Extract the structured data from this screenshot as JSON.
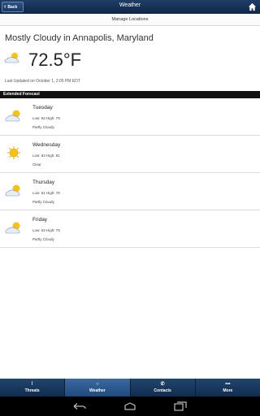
{
  "topbar": {
    "back_label": "Back",
    "title": "Weather"
  },
  "manage": {
    "label": "Manage Locations"
  },
  "current": {
    "title": "Mostly Cloudy in Annapolis, Maryland",
    "temp": "72.5°F",
    "icon": "partly-cloudy-icon",
    "last_updated": "Last Updated on October 1, 2:05 PM EDT"
  },
  "forecast": {
    "header": "Extended Forecast",
    "days": [
      {
        "day": "Tuesday",
        "lohi": "Low: 63 High: 79",
        "cond": "Partly Cloudy",
        "icon": "partly-cloudy-icon"
      },
      {
        "day": "Wednesday",
        "lohi": "Low: 63 High: 81",
        "cond": "Clear",
        "icon": "sun-icon"
      },
      {
        "day": "Thursday",
        "lohi": "Low: 61 High: 79",
        "cond": "Partly Cloudy",
        "icon": "partly-cloudy-icon"
      },
      {
        "day": "Friday",
        "lohi": "Low: 63 High: 79",
        "cond": "Partly Cloudy",
        "icon": "partly-cloudy-icon"
      }
    ]
  },
  "tabs": [
    {
      "label": "Threats",
      "icon": "!"
    },
    {
      "label": "Weather",
      "icon": "○"
    },
    {
      "label": "Contacts",
      "icon": "✆"
    },
    {
      "label": "More",
      "icon": "•••"
    }
  ],
  "colors": {
    "topbar": "#1a365d",
    "tabbar": "#1b3a62",
    "forecast_header": "#111111"
  }
}
